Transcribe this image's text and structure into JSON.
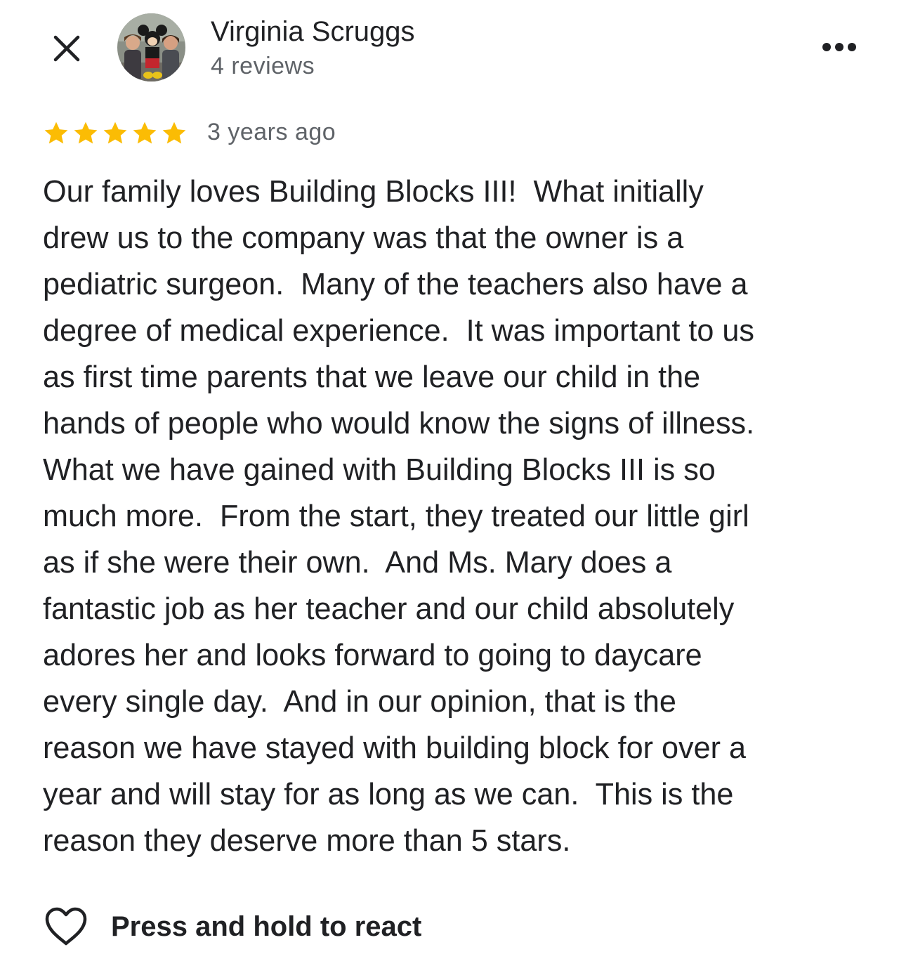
{
  "header": {
    "close_icon": "close-icon",
    "avatar_icon": "avatar",
    "reviewer_name": "Virginia Scruggs",
    "review_count": "4 reviews",
    "more_icon": "more-horizontal-icon"
  },
  "rating": {
    "stars": 5,
    "max_stars": 5,
    "star_color": "#fbbc04",
    "timestamp": "3 years ago"
  },
  "review": {
    "lines": [
      "Our family loves Building Blocks III!  What initially",
      "drew us to the company was that the owner is a",
      "pediatric surgeon.  Many of the teachers also have a",
      "degree of medical experience.  It was important to us",
      "as first time parents that we leave our child in the",
      "hands of people who would know the signs of illness.",
      "What we have gained with Building Blocks III is so",
      "much more.  From the start, they treated our little girl",
      "as if she were their own.  And Ms. Mary does a",
      "fantastic job as her teacher and our child absolutely",
      "adores her and looks forward to going to daycare",
      "every single day.  And in our opinion, that is the",
      "reason we have stayed with building block for over a",
      "year and will stay for as long as we can.  This is the",
      "reason they deserve more than 5 stars."
    ]
  },
  "react": {
    "icon": "heart-outline-icon",
    "label": "Press and hold to react"
  }
}
